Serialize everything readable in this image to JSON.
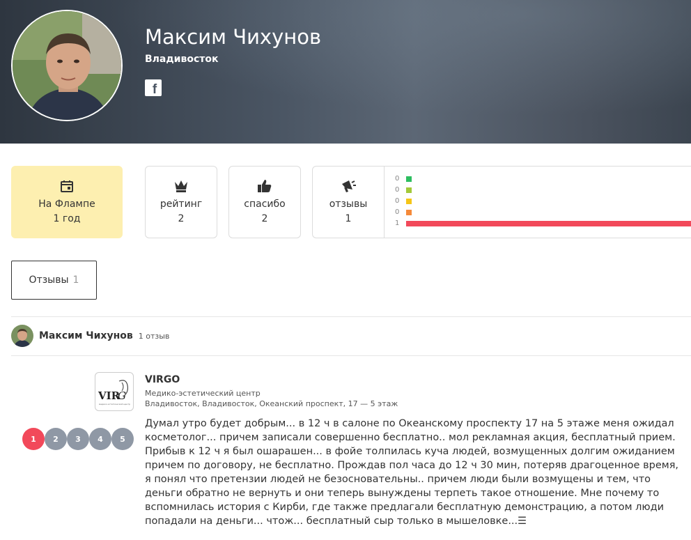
{
  "profile": {
    "name": "Максим Чихунов",
    "city": "Владивосток",
    "social": "facebook"
  },
  "stats": {
    "flamp": {
      "label": "На Флампе",
      "value": "1 год",
      "icon": "calendar-icon"
    },
    "rating": {
      "label": "рейтинг",
      "value": "2",
      "icon": "crown-icon"
    },
    "thanks": {
      "label": "спасибо",
      "value": "2",
      "icon": "thumbs-up-icon"
    },
    "reviews": {
      "label": "отзывы",
      "value": "1",
      "icon": "megaphone-icon"
    }
  },
  "distribution": [
    {
      "count": "0",
      "color": "#2dbe60"
    },
    {
      "count": "0",
      "color": "#a3c93a"
    },
    {
      "count": "0",
      "color": "#f5c518"
    },
    {
      "count": "0",
      "color": "#f58a3a"
    },
    {
      "count": "1",
      "color": "#f2495a"
    }
  ],
  "tabs": {
    "reviews_label": "Отзывы",
    "reviews_count": "1"
  },
  "review": {
    "author": "Максим Чихунов",
    "author_count": "1 отзыв",
    "org_name": "VIRGO",
    "org_type": "Медико-эстетический центр",
    "org_address": "Владивосток, Владивосток, Океанский проспект, 17 — 5 этаж",
    "rating": 1,
    "stars": [
      "1",
      "2",
      "3",
      "4",
      "5"
    ],
    "text": "Думал утро будет добрым... в 12 ч в салоне по Океанскому проспекту 17 на 5 этаже меня ожидал косметолог... причем записали совершенно бесплатно.. мол рекламная акция, бесплатный прием. Прибыв к 12 ч я был ошарашен... в фойе толпилась куча людей, возмущенных долгим ожиданием причем по договору, не бесплатно. Прождав пол часа до 12 ч 30 мин, потеряв драгоценное время, я понял что претензии людей не безосновательны.. причем люди были возмущены и тем, что деньги обратно не вернуть и они теперь вынуждены терпеть такое отношение. Мне почему то вспомнилась история с Кирби, где также предлагали бесплатную демонстрацию, а потом люди попадали на деньги... чтож... бесплатный сыр только в мышеловке...",
    "more": "☰"
  }
}
